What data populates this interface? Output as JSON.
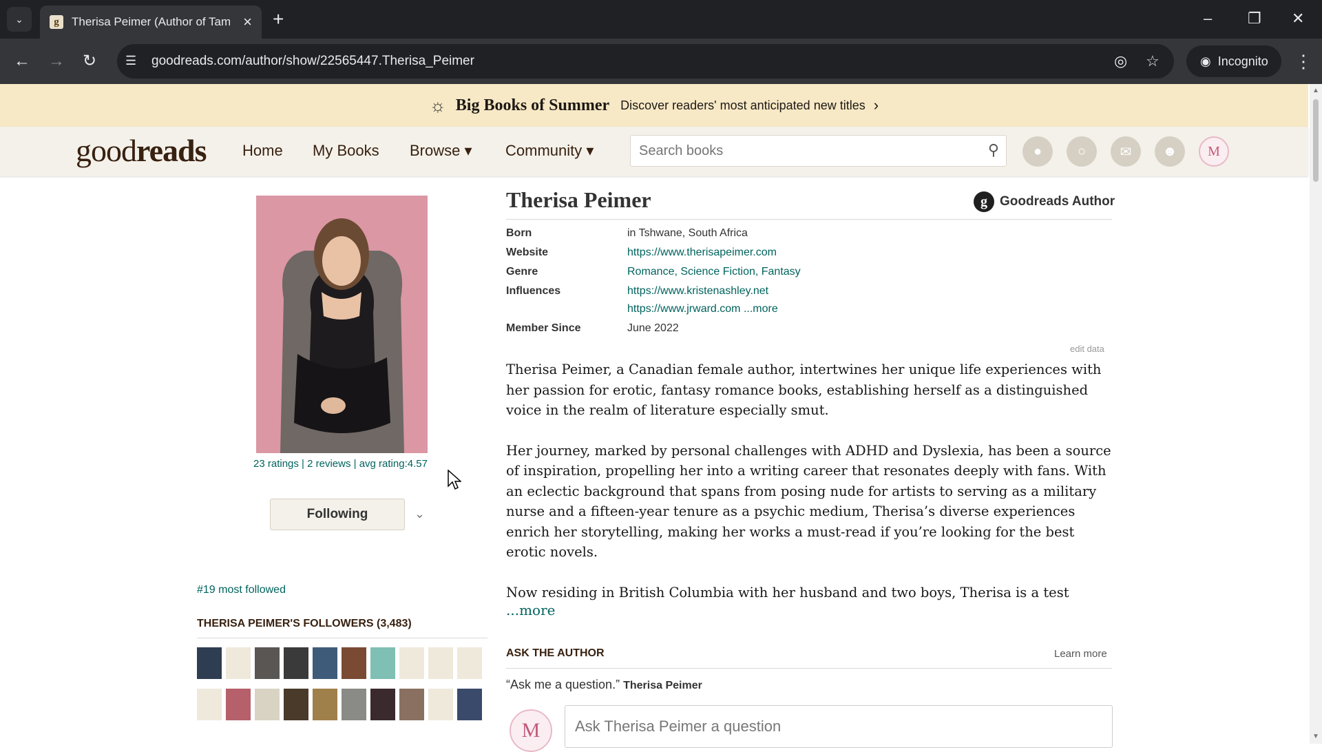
{
  "browser": {
    "tab_title": "Therisa Peimer (Author of Tami",
    "favicon": "g",
    "url": "goodreads.com/author/show/22565447.Therisa_Peimer",
    "incognito_label": "Incognito"
  },
  "banner": {
    "title": "Big Books of Summer",
    "subtitle": "Discover readers' most anticipated new titles"
  },
  "header": {
    "logo_light": "good",
    "logo_bold": "reads",
    "nav": {
      "home": "Home",
      "my_books": "My Books",
      "browse": "Browse ▾",
      "community": "Community ▾"
    },
    "search_placeholder": "Search books"
  },
  "author": {
    "name": "Therisa Peimer",
    "badge_letter": "g",
    "badge_label": "Goodreads Author",
    "details": {
      "born_label": "Born",
      "born_value": "in Tshwane, South Africa",
      "website_label": "Website",
      "website_value": "https://www.therisapeimer.com",
      "genre_label": "Genre",
      "genre_value": "Romance, Science Fiction, Fantasy",
      "influences_label": "Influences",
      "influence_1": "https://www.kristenashley.net",
      "influence_2": "https://www.jrward.com",
      "influence_more": "...more",
      "member_since_label": "Member Since",
      "member_since_value": "June 2022"
    },
    "edit_data": "edit data",
    "bio": {
      "p1": "Therisa Peimer, a Canadian female author, intertwines her unique life experiences with her passion for erotic, fantasy romance books, establishing herself as a distinguished voice in the realm of literature especially smut.",
      "p2": "Her journey, marked by personal challenges with ADHD and Dyslexia, has been a source of inspiration, propelling her into a writing career that resonates deeply with fans. With an eclectic background that spans from posing nude for artists to serving as a military nurse and a fifteen-year tenure as a psychic medium, Therisa’s diverse experiences enrich her storytelling, making her works a must-read if you’re looking for the best erotic novels.",
      "p3": "Now residing in British Columbia with her husband and two boys, Therisa is a test",
      "more": "...more"
    }
  },
  "left": {
    "ratings": "23 ratings",
    "reviews": "2 reviews",
    "avg_rating": "avg rating:4.57",
    "follow_button": "Following",
    "most_followed": "#19 most followed",
    "followers_title": "THERISA PEIMER'S FOLLOWERS (3,483)",
    "follower_avatar_colors": [
      "#2f3d52",
      "#efe9dc",
      "#5a5654",
      "#3a3a3a",
      "#3e5c7a",
      "#7a4a33",
      "#7fbfb4",
      "#efe9dc",
      "#efe9dc",
      "#efe9dc",
      "#efe9dc",
      "#b5606a",
      "#d9d3c4",
      "#4a3a2a",
      "#a0804a",
      "#8a8a86",
      "#3a2a2e",
      "#8a7060",
      "#efe9dc",
      "#3a4a6a"
    ]
  },
  "ask": {
    "title": "ASK THE AUTHOR",
    "learn_more": "Learn more",
    "quote": "“Ask me a question.”",
    "quote_author": "Therisa Peimer",
    "avatar_letter": "M",
    "input_placeholder": "Ask Therisa Peimer a question"
  }
}
